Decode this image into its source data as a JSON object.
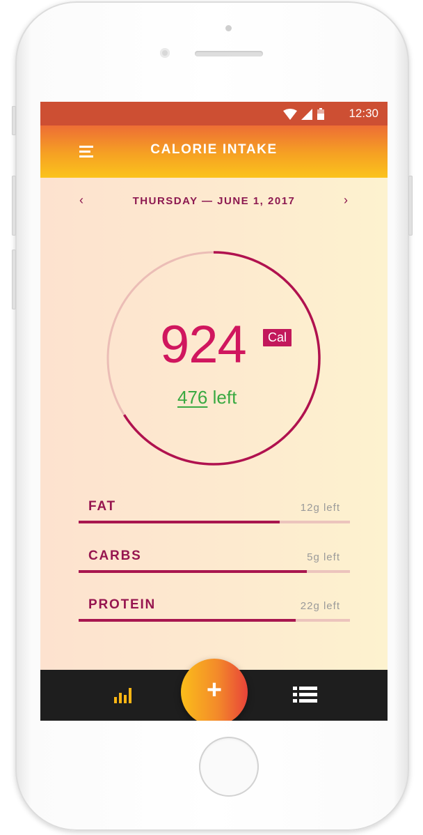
{
  "status_bar": {
    "time": "12:30",
    "icons": [
      "wifi-icon",
      "cellular-signal-icon",
      "battery-icon"
    ]
  },
  "app_bar": {
    "title": "CALORIE INTAKE",
    "menu_icon": "hamburger-menu-icon"
  },
  "date_nav": {
    "prev": "‹",
    "date": "THURSDAY — JUNE 1, 2017",
    "next": "›"
  },
  "summary": {
    "consumed": "924",
    "unit": "Cal",
    "left_amount": "476",
    "left_label": "left",
    "progress_fraction": 0.66
  },
  "macros": [
    {
      "name": "FAT",
      "remaining": "12g left",
      "progress_fraction": 0.74
    },
    {
      "name": "CARBS",
      "remaining": "5g left",
      "progress_fraction": 0.84
    },
    {
      "name": "PROTEIN",
      "remaining": "22g left",
      "progress_fraction": 0.8
    }
  ],
  "bottom_nav": {
    "left_icon": "bar-chart-icon",
    "fab_label": "+",
    "right_icon": "list-icon"
  },
  "colors": {
    "accent": "#c2185b",
    "remaining_text": "#39a941",
    "header_top": "#ed6d35",
    "header_bottom": "#fbc31c",
    "nav_bg": "#1e1e1e"
  }
}
